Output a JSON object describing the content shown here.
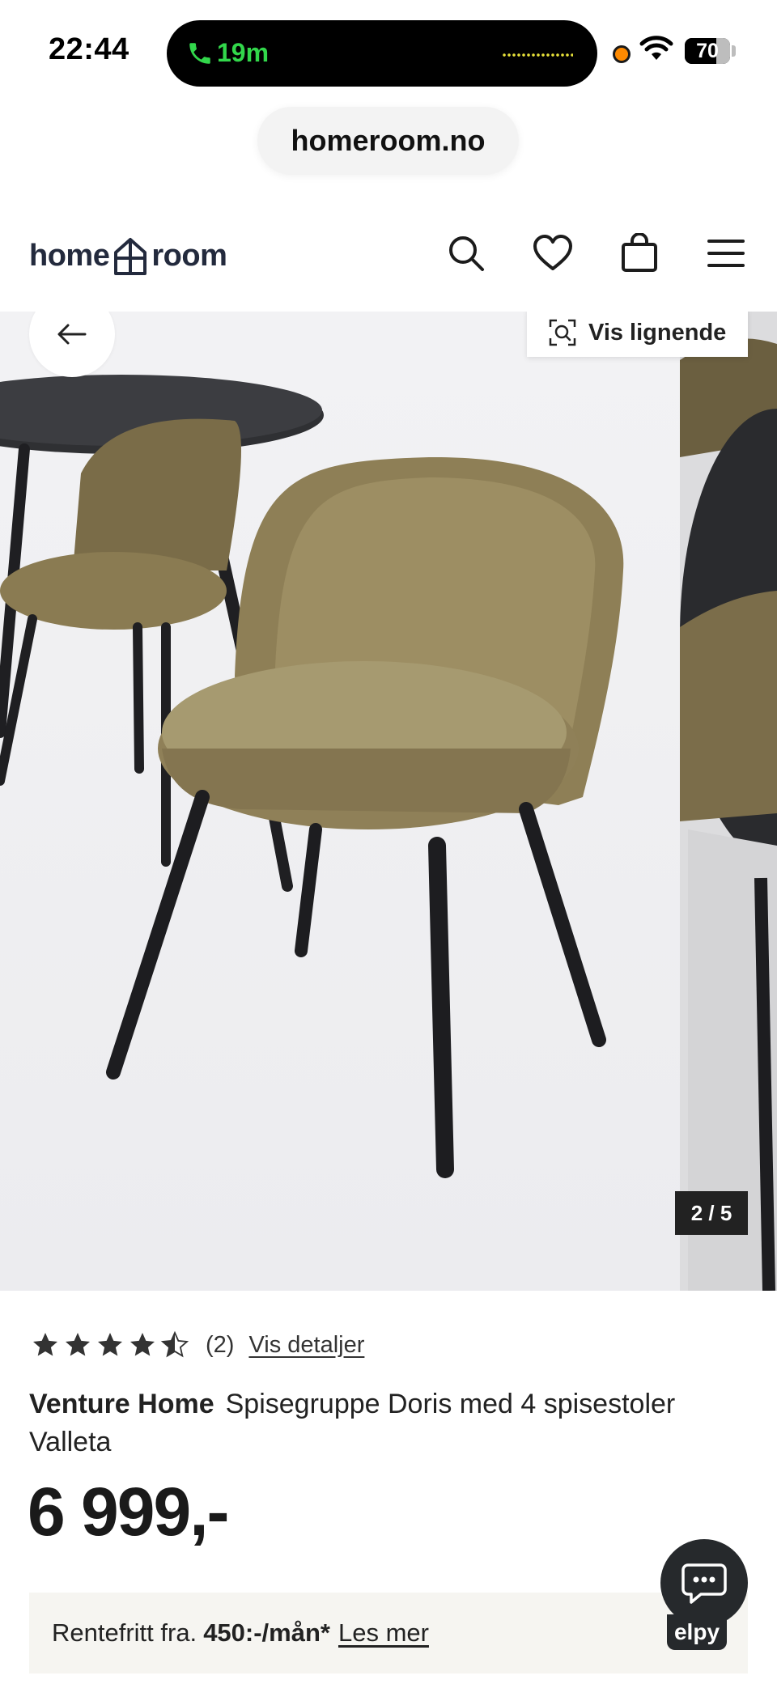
{
  "status_bar": {
    "time": "22:44",
    "call_duration": "19m",
    "battery": "70",
    "battery_level": 0.7
  },
  "browser": {
    "url": "homeroom.no"
  },
  "header": {
    "logo_left": "home",
    "logo_right": "room",
    "icons": [
      "search-icon",
      "heart-icon",
      "bag-icon",
      "menu-icon"
    ]
  },
  "gallery": {
    "similar_label": "Vis lignende",
    "counter": "2 / 5",
    "image_description_icon": "chair-photo"
  },
  "product": {
    "rating_value": 4.5,
    "rating_count": "(2)",
    "details_link": "Vis detaljer",
    "brand": "Venture Home",
    "name": "Spisegruppe Doris med 4 spisestoler Valleta",
    "price": "6 999,-"
  },
  "finance": {
    "prefix": "Rentefritt fra.",
    "amount": "450:-/mån*",
    "link": "Les mer"
  },
  "chat": {
    "brand": "elpy"
  },
  "colors": {
    "call_green": "#32d74b",
    "logo_navy": "#232a3d",
    "chat_dark": "#26292c",
    "banner_bg": "#f6f5f1"
  }
}
